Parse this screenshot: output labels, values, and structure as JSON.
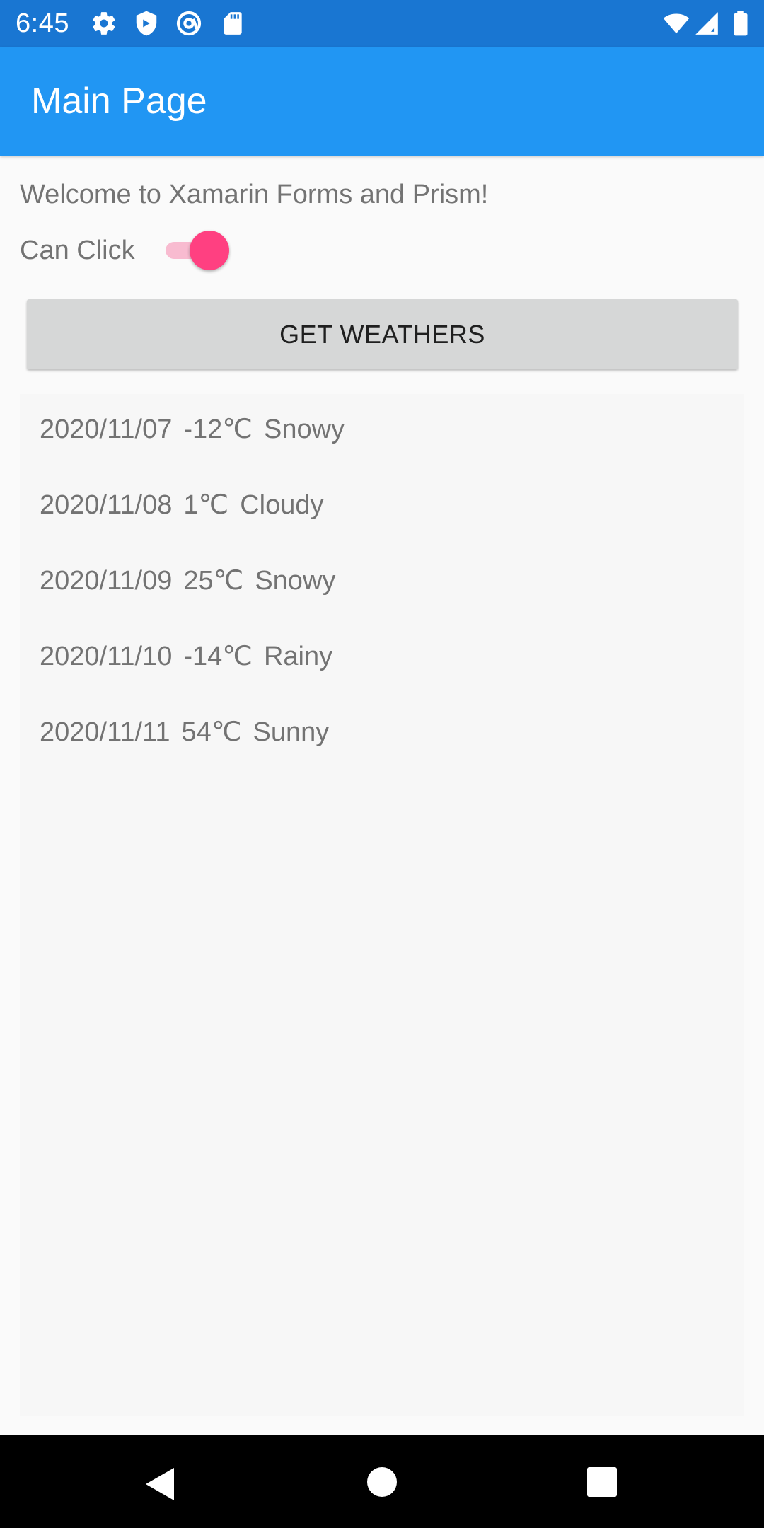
{
  "status_bar": {
    "time": "6:45",
    "icons_left": [
      "settings-icon",
      "shield-icon",
      "at-sign-icon",
      "sd-card-icon"
    ],
    "icons_right": [
      "wifi-icon",
      "signal-icon",
      "battery-icon"
    ],
    "background_color": "#1976d2"
  },
  "app_bar": {
    "title": "Main Page",
    "background_color": "#2196f3"
  },
  "main": {
    "welcome_text": "Welcome to Xamarin Forms and Prism!",
    "can_click_label": "Can Click",
    "can_click_enabled": true,
    "switch_accent_color": "#ff4081",
    "get_weathers_label": "GET WEATHERS"
  },
  "weathers": [
    {
      "date": "2020/11/07",
      "temperature": "-12℃",
      "condition": "Snowy"
    },
    {
      "date": "2020/11/08",
      "temperature": "1℃",
      "condition": "Cloudy"
    },
    {
      "date": "2020/11/09",
      "temperature": "25℃",
      "condition": "Snowy"
    },
    {
      "date": "2020/11/10",
      "temperature": "-14℃",
      "condition": "Rainy"
    },
    {
      "date": "2020/11/11",
      "temperature": "54℃",
      "condition": "Sunny"
    }
  ],
  "nav_bar": {
    "buttons": [
      "back-icon",
      "home-icon",
      "recents-icon"
    ]
  }
}
